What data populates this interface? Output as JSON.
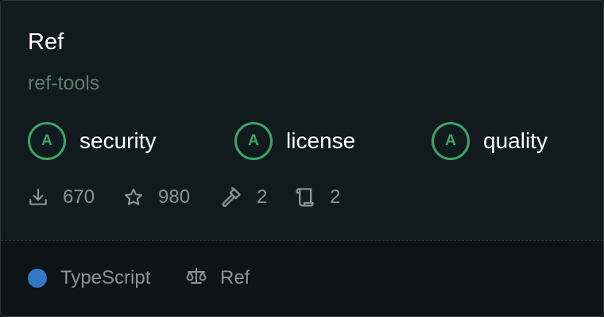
{
  "card": {
    "title": "Ref",
    "subtitle": "ref-tools"
  },
  "scores": [
    {
      "grade": "A",
      "label": "security"
    },
    {
      "grade": "A",
      "label": "license"
    },
    {
      "grade": "A",
      "label": "quality"
    }
  ],
  "stats": {
    "downloads": "670",
    "stars": "980",
    "builds": "2",
    "pages": "2"
  },
  "footer": {
    "language": "TypeScript",
    "license": "Ref"
  },
  "colors": {
    "grade": "#3da46a",
    "language_dot": "#3178c6",
    "background": "#121b1d"
  },
  "icons": {
    "downloads": "download-icon",
    "stars": "star-icon",
    "builds": "hammer-icon",
    "pages": "scroll-icon",
    "license": "balance-scale-icon"
  }
}
